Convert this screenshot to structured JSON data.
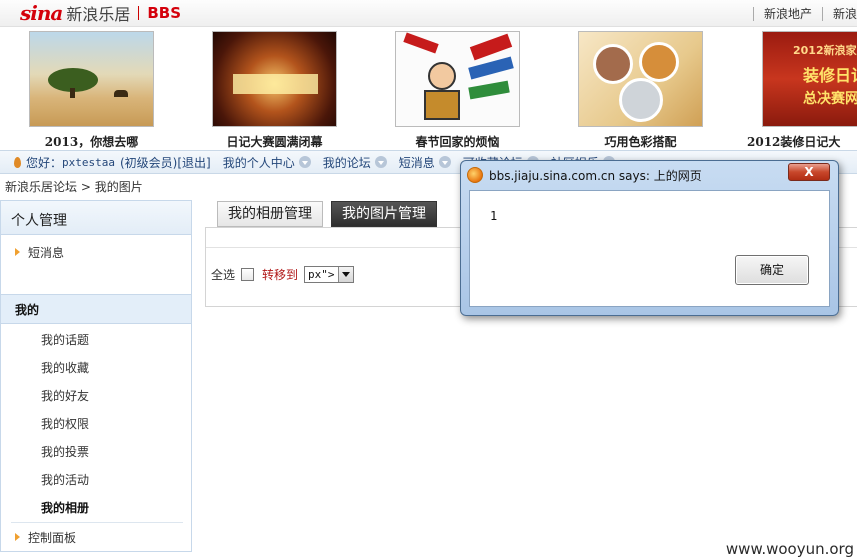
{
  "header": {
    "logo_sina": "sina",
    "logo_site": "新浪乐居",
    "logo_bbs": "BBS",
    "links": [
      "新浪地产",
      "新浪"
    ]
  },
  "strip": {
    "items": [
      {
        "caption": "2013，你想去哪"
      },
      {
        "caption": "日记大赛圆满闭幕"
      },
      {
        "caption": "春节回家的烦恼"
      },
      {
        "caption": "巧用色彩搭配"
      },
      {
        "caption": "2012装修日记大"
      }
    ],
    "banner_text": [
      "2012新浪家居",
      "装修日记",
      "总决赛网"
    ]
  },
  "userbar": {
    "greeting": "您好：",
    "username": "pxtestaa",
    "level": "(初级会员)",
    "logout": "[退出]",
    "menus": [
      "我的个人中心",
      "我的论坛",
      "短消息",
      "可收藏论坛",
      "社区娱乐"
    ]
  },
  "breadcrumb": {
    "home": "新浪乐居论坛",
    "sep": ">",
    "current": "我的图片"
  },
  "sidebar": {
    "title": "个人管理",
    "short_msg": "短消息",
    "group_label": "我的",
    "sub_items": [
      "我的话题",
      "我的收藏",
      "我的好友",
      "我的权限",
      "我的投票",
      "我的活动",
      "我的相册"
    ],
    "control_panel": "控制面板"
  },
  "main": {
    "tabs": [
      "我的相册管理",
      "我的图片管理"
    ],
    "select_all": "全选",
    "move_to": "转移到",
    "select_value": "px\">"
  },
  "dialog": {
    "title": "bbs.jiaju.sina.com.cn says: 上的网页",
    "close": "X",
    "message": "1",
    "ok": "确定"
  },
  "watermark": "www.wooyun.org"
}
